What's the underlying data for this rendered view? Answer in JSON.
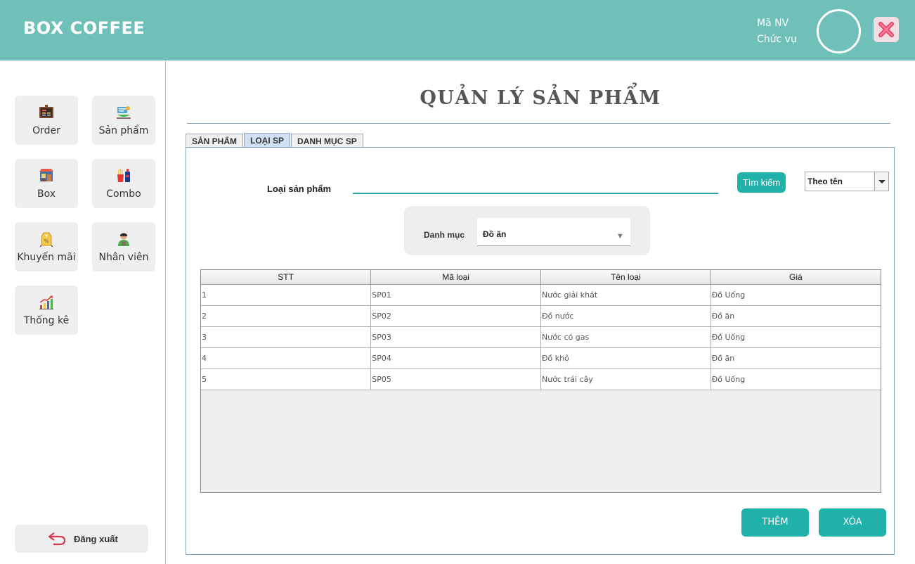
{
  "header": {
    "brand": "BOX COFFEE",
    "employee_id_label": "Mã NV",
    "position_label": "Chức vụ",
    "accent_color": "#6fc0b8"
  },
  "sidebar": {
    "items": [
      {
        "label": "Order",
        "icon": "menu-board-icon"
      },
      {
        "label": "Sản phẩm",
        "icon": "product-tray-icon"
      },
      {
        "label": "Box",
        "icon": "store-box-icon"
      },
      {
        "label": "Combo",
        "icon": "fries-drink-combo-icon"
      },
      {
        "label": "Khuyến mãi",
        "icon": "discount-tag-icon"
      },
      {
        "label": "Nhân viên",
        "icon": "employee-icon"
      },
      {
        "label": "Thống kê",
        "icon": "bar-chart-icon"
      }
    ],
    "logout_label": "Đăng xuất"
  },
  "main": {
    "title": "QUẢN LÝ SẢN PHẨM",
    "tabs": [
      {
        "label": "SẢN PHẨM",
        "active": false
      },
      {
        "label": "LOẠI SP",
        "active": true
      },
      {
        "label": "DANH MỤC SP",
        "active": false
      }
    ],
    "search": {
      "label": "Loại sản phẩm",
      "value": "",
      "button_label": "Tìm kiếm",
      "mode_selected": "Theo tên"
    },
    "category": {
      "label": "Danh mục",
      "selected": "Đồ ăn"
    },
    "table": {
      "columns": [
        "STT",
        "Mã loại",
        "Tên loại",
        "Giá"
      ],
      "rows": [
        [
          "1",
          "SP01",
          "Nước giải khát",
          "Đồ Uống"
        ],
        [
          "2",
          "SP02",
          "Đồ nước",
          "Đồ ăn"
        ],
        [
          "3",
          "SP03",
          "Nước có gas",
          "Đồ Uống"
        ],
        [
          "4",
          "SP04",
          "Đồ khô",
          "Đồ ăn"
        ],
        [
          "5",
          "SP05",
          "Nước trái cây",
          "Đồ Uống"
        ]
      ]
    },
    "actions": {
      "add_label": "THÊM",
      "delete_label": "XÓA",
      "button_color": "#20b2aa"
    }
  }
}
